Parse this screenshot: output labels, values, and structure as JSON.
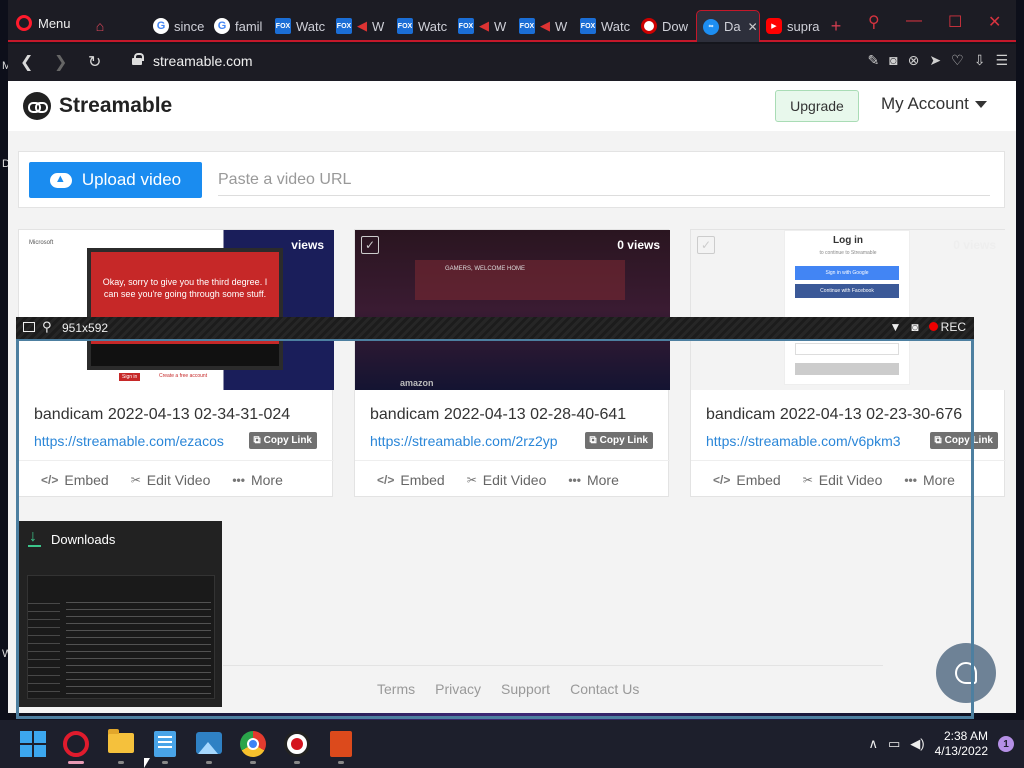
{
  "browser": {
    "menu_label": "Menu",
    "tabs": [
      {
        "label": "",
        "icon": "gamepad-icon"
      },
      {
        "label": "since",
        "icon": "google-icon"
      },
      {
        "label": "famil",
        "icon": "google-icon"
      },
      {
        "label": "Watc",
        "icon": "fox-icon"
      },
      {
        "label": "W",
        "icon": "fox-icon"
      },
      {
        "label": "Watc",
        "icon": "fox-icon"
      },
      {
        "label": "W",
        "icon": "fox-icon"
      },
      {
        "label": "W",
        "icon": "fox-icon"
      },
      {
        "label": "Watc",
        "icon": "fox-icon"
      },
      {
        "label": "Dow",
        "icon": "record-icon"
      },
      {
        "label": "Da",
        "icon": "streamable-icon"
      },
      {
        "label": "supra",
        "icon": "youtube-icon"
      }
    ],
    "url": "streamable.com"
  },
  "site": {
    "logo_text": "Streamable",
    "upgrade_label": "Upgrade",
    "account_label": "My Account",
    "upload_label": "Upload video",
    "url_placeholder": "Paste a video URL"
  },
  "videos": [
    {
      "title": "bandicam 2022-04-13 02-34-31-024",
      "link": "https://streamable.com/ezacos",
      "views": "views",
      "thumb_text": "Okay, sorry to give you the third degree. I can see you're going through some stuff.",
      "thumb_sub": "Microsoft",
      "thumb_btn1": "Sign in",
      "thumb_btn2": "Create a free account"
    },
    {
      "title": "bandicam 2022-04-13 02-28-40-641",
      "link": "https://streamable.com/2rz2yp",
      "views": "0 views",
      "thumb_text": "GAMERS, WELCOME HOME",
      "thumb_sub": "amazon"
    },
    {
      "title": "bandicam 2022-04-13 02-23-30-676",
      "link": "https://streamable.com/v6pkm3",
      "views": "0 views",
      "thumb_text": "Log in",
      "thumb_sub": "to continue to Streamable",
      "thumb_btn1": "Sign in with Google",
      "thumb_btn2": "Continue with Facebook"
    }
  ],
  "card_actions": {
    "copy_label": "Copy Link",
    "embed": "Embed",
    "edit": "Edit Video",
    "more": "More"
  },
  "footer": {
    "terms": "Terms",
    "privacy": "Privacy",
    "support": "Support",
    "contact": "Contact Us"
  },
  "bandicam": {
    "size": "951x592",
    "rec_label": "REC"
  },
  "downloads": {
    "title": "Downloads"
  },
  "taskbar": {
    "time": "2:38 AM",
    "date": "4/13/2022",
    "notification_count": "1"
  }
}
